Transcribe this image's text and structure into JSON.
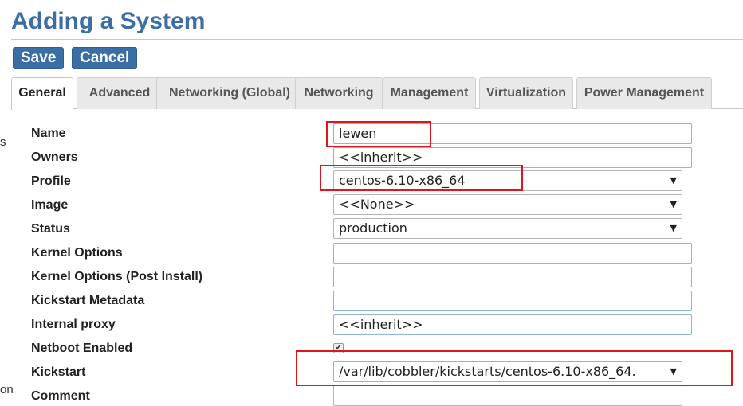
{
  "page": {
    "title": "Adding a System"
  },
  "toolbar": {
    "save_label": "Save",
    "cancel_label": "Cancel"
  },
  "left_stub": {
    "text_top": "s",
    "text_bottom": "on"
  },
  "tabs": [
    {
      "label": "General",
      "active": true
    },
    {
      "label": "Advanced",
      "active": false
    },
    {
      "label": "Networking (Global)",
      "active": false
    },
    {
      "label": "Networking",
      "active": false
    },
    {
      "label": "Management",
      "active": false
    },
    {
      "label": "Virtualization",
      "active": false
    },
    {
      "label": "Power Management",
      "active": false
    }
  ],
  "form": {
    "name": {
      "label": "Name",
      "value": "lewen"
    },
    "owners": {
      "label": "Owners",
      "value": "<<inherit>>"
    },
    "profile": {
      "label": "Profile",
      "value": "centos-6.10-x86_64"
    },
    "image": {
      "label": "Image",
      "value": "<<None>>"
    },
    "status": {
      "label": "Status",
      "value": "production"
    },
    "kernel_options": {
      "label": "Kernel Options",
      "value": ""
    },
    "kernel_options_post": {
      "label": "Kernel Options (Post Install)",
      "value": ""
    },
    "kickstart_metadata": {
      "label": "Kickstart Metadata",
      "value": ""
    },
    "internal_proxy": {
      "label": "Internal proxy",
      "value": "<<inherit>>"
    },
    "netboot_enabled": {
      "label": "Netboot Enabled",
      "checked": true
    },
    "kickstart": {
      "label": "Kickstart",
      "value": "/var/lib/cobbler/kickstarts/centos-6.10-x86_64."
    },
    "comment": {
      "label": "Comment",
      "value": ""
    }
  },
  "icons": {
    "select_caret": "caret-down-icon",
    "checkbox_mark": "check-icon"
  },
  "colors": {
    "accent": "#3a6ea5",
    "highlight": "#e0141e",
    "input_border": "#8fb3da"
  }
}
